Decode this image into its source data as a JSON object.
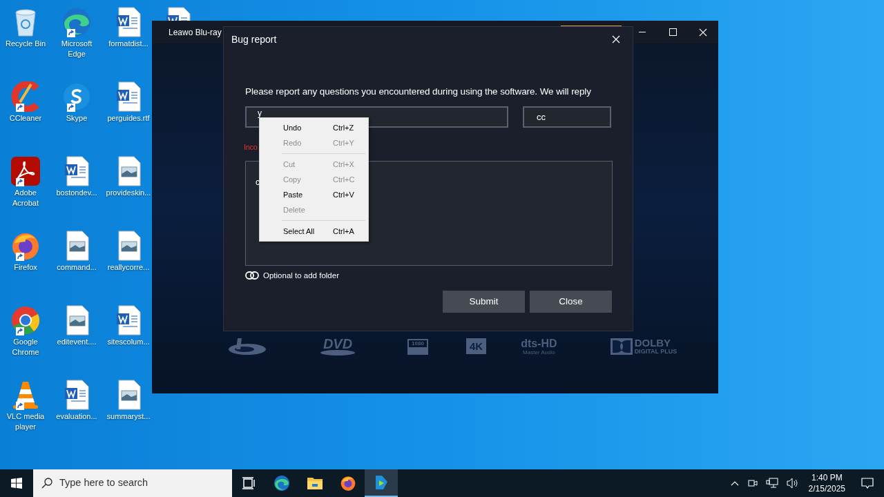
{
  "desktop_icons": [
    {
      "label": "Recycle Bin",
      "kind": "recycle",
      "shortcut": false
    },
    {
      "label": "Microsoft Edge",
      "kind": "edge",
      "shortcut": true
    },
    {
      "label": "formatdist...",
      "kind": "word",
      "shortcut": false
    },
    {
      "label": "CCleaner",
      "kind": "ccleaner",
      "shortcut": true
    },
    {
      "label": "Skype",
      "kind": "skype",
      "shortcut": true
    },
    {
      "label": "perguides.rtf",
      "kind": "word",
      "shortcut": false
    },
    {
      "label": "Adobe Acrobat",
      "kind": "acrobat",
      "shortcut": true
    },
    {
      "label": "bostondev...",
      "kind": "word",
      "shortcut": false
    },
    {
      "label": "provideskin...",
      "kind": "image",
      "shortcut": false
    },
    {
      "label": "Firefox",
      "kind": "firefox",
      "shortcut": true
    },
    {
      "label": "command...",
      "kind": "image",
      "shortcut": false
    },
    {
      "label": "reallycorre...",
      "kind": "image",
      "shortcut": false
    },
    {
      "label": "Google Chrome",
      "kind": "chrome",
      "shortcut": true
    },
    {
      "label": "editevent....",
      "kind": "image",
      "shortcut": false
    },
    {
      "label": "sitescolum...",
      "kind": "word",
      "shortcut": false
    },
    {
      "label": "VLC media player",
      "kind": "vlc",
      "shortcut": true
    },
    {
      "label": "evaluation...",
      "kind": "word",
      "shortcut": false
    },
    {
      "label": "summaryst...",
      "kind": "image",
      "shortcut": false
    }
  ],
  "app_window": {
    "title": "Leawo Blu-ray",
    "format_logos": [
      {
        "kind": "bluray"
      },
      {
        "kind": "dvd",
        "label": "DVD"
      },
      {
        "kind": "fullhd",
        "label": "1080"
      },
      {
        "kind": "box",
        "label": "4K"
      },
      {
        "kind": "dts",
        "label": "dts-HD",
        "sublabel": "Master Audio"
      },
      {
        "kind": "dolby",
        "label": "DOLBY",
        "sublabel": "DIGITAL PLUS"
      }
    ]
  },
  "dialog": {
    "title": "Bug report",
    "message": "Please report any questions you encountered during using the software. We will reply",
    "email_field": {
      "value": "y"
    },
    "cc_field": {
      "value": "cc"
    },
    "error": "Inco",
    "description_field": {
      "value": "c"
    },
    "attach_link": "Optional to add folder",
    "buttons": [
      "Submit",
      "Close"
    ]
  },
  "context_menu": [
    {
      "kind": "item",
      "label": "Undo",
      "shortcut": "Ctrl+Z",
      "disabled": false
    },
    {
      "kind": "item",
      "label": "Redo",
      "shortcut": "Ctrl+Y",
      "disabled": true
    },
    {
      "kind": "separator"
    },
    {
      "kind": "item",
      "label": "Cut",
      "shortcut": "Ctrl+X",
      "disabled": true
    },
    {
      "kind": "item",
      "label": "Copy",
      "shortcut": "Ctrl+C",
      "disabled": true
    },
    {
      "kind": "item",
      "label": "Paste",
      "shortcut": "Ctrl+V",
      "disabled": false
    },
    {
      "kind": "item",
      "label": "Delete",
      "disabled": true
    },
    {
      "kind": "separator"
    },
    {
      "kind": "item",
      "label": "Select All",
      "shortcut": "Ctrl+A",
      "disabled": false
    }
  ],
  "taskbar": {
    "search_placeholder": "Type here to search",
    "apps": [
      {
        "kind": "taskview",
        "selected": false
      },
      {
        "kind": "edge",
        "selected": false
      },
      {
        "kind": "explorer",
        "selected": false
      },
      {
        "kind": "firefox",
        "selected": false
      },
      {
        "kind": "leawo",
        "selected": true
      }
    ],
    "time": "1:40 PM",
    "date": "2/15/2025"
  }
}
